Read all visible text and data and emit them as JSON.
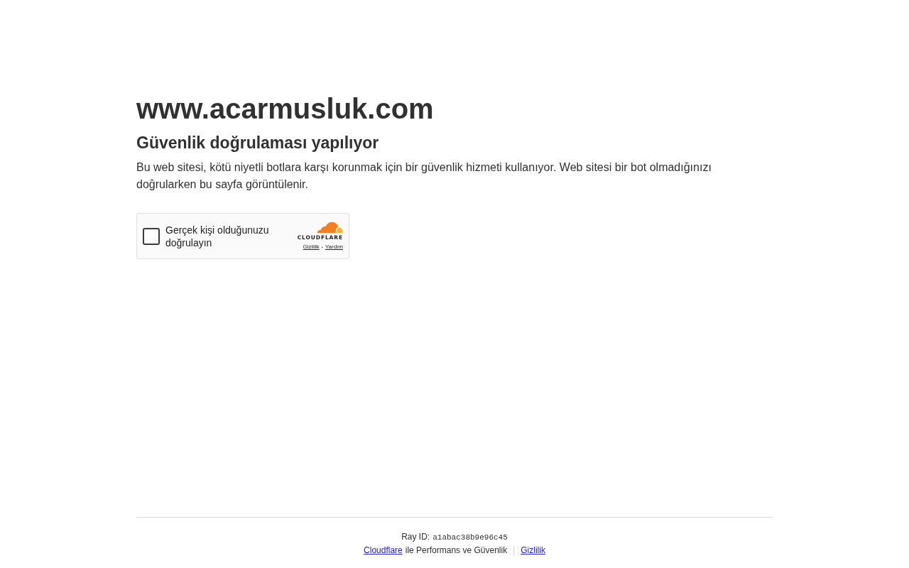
{
  "page": {
    "title": "www.acarmusluk.com",
    "heading": "Güvenlik doğrulaması yapılıyor",
    "description": "Bu web sitesi, kötü niyetli botlara karşı korunmak için bir güvenlik hizmeti kullanıyor. Web sitesi bir bot olmadığınızı doğrularken bu sayfa görüntülenir."
  },
  "challenge_widget": {
    "checkbox": {
      "label": "Gerçek kişi olduğunuzu doğrulayın",
      "checked": false
    },
    "logo_text": "CLOUDFLARE",
    "links": [
      "Gizlilik",
      "Yardım"
    ],
    "separator": "•"
  },
  "footer": {
    "ray_id_label": "Ray ID:",
    "ray_id": "a1abac38b9e96c45",
    "provider_link": "Cloudflare",
    "provider_text": "ile Performans ve Güvenlik",
    "separator": "|",
    "privacy_link": "Gizlilik"
  }
}
